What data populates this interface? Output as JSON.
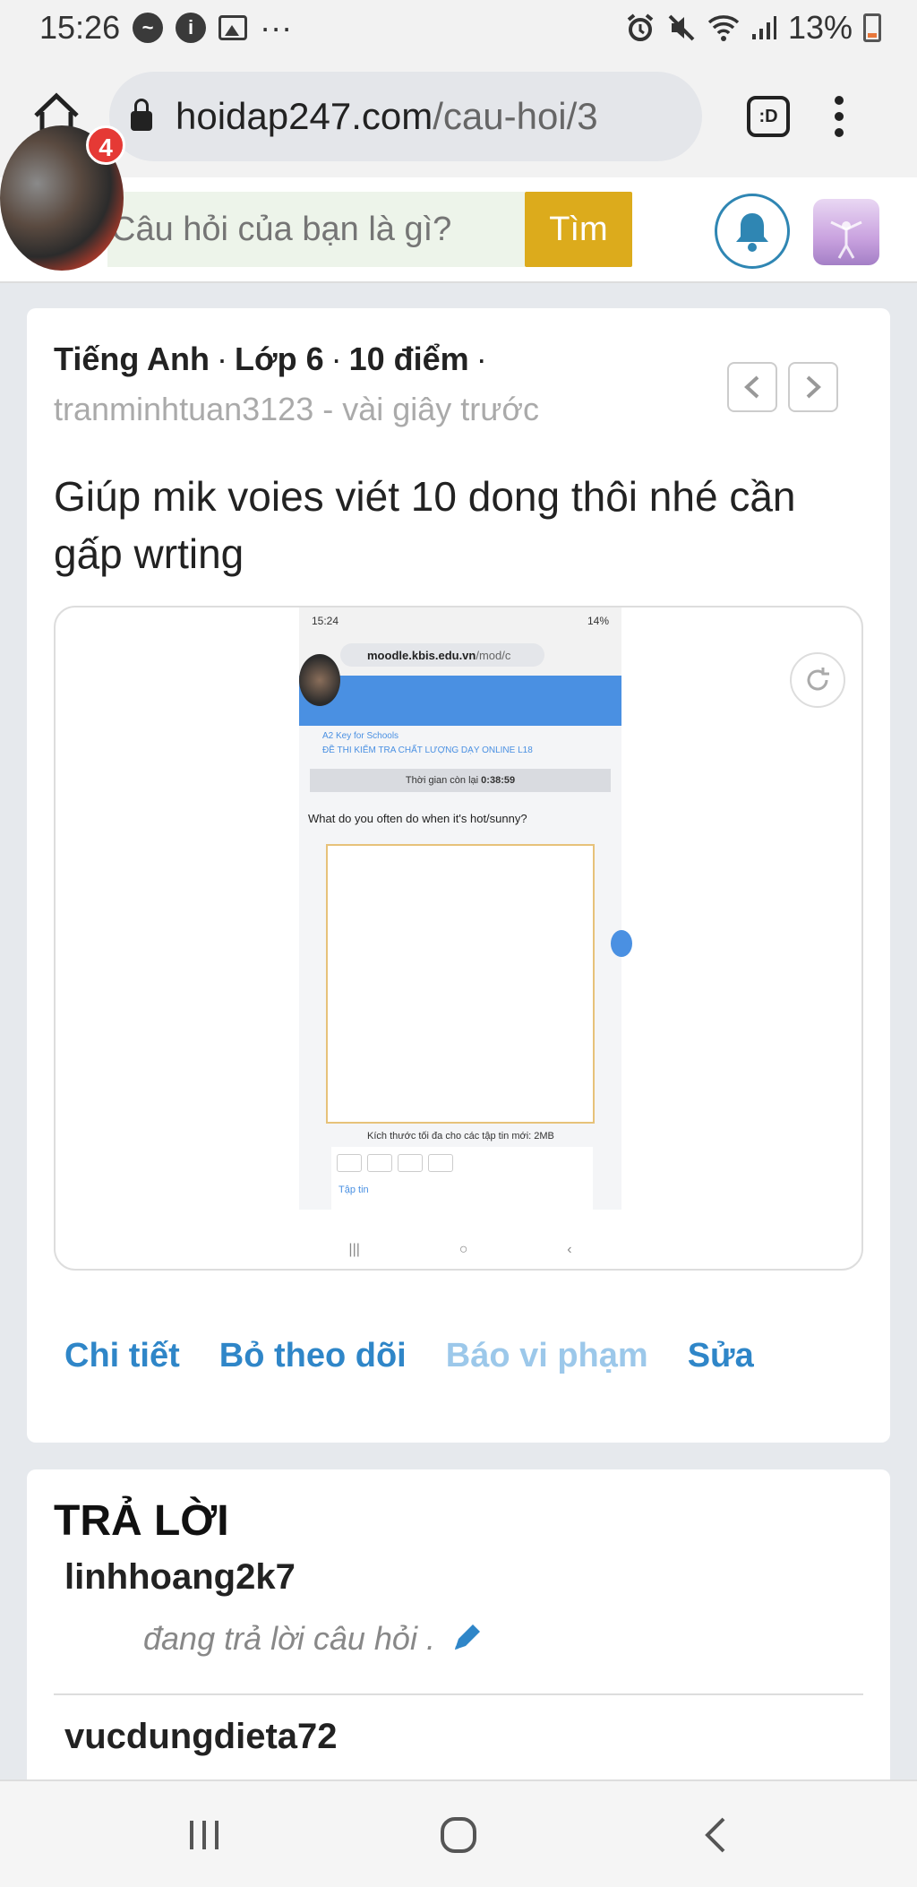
{
  "status_bar": {
    "time": "15:26",
    "more": "···",
    "battery": "13%"
  },
  "browser": {
    "url_domain": "hoidap247.com",
    "url_path": "/cau-hoi/3",
    "tabs_label": ":D"
  },
  "chat_head": {
    "badge": "4"
  },
  "site_header": {
    "search_placeholder": "Câu hỏi của bạn là gì?",
    "search_button": "Tìm"
  },
  "question": {
    "subject": "Tiếng Anh",
    "grade": "Lớp 6",
    "points": "10 điểm",
    "separator": "·",
    "author": "tranminhtuan3123",
    "time": "vài giây trước",
    "text": "Giúp mik voies viét 10 dong thôi nhé cần gấp wrting",
    "attachment": {
      "status_time": "15:24",
      "status_right": "14%",
      "url_domain": "moodle.kbis.edu.vn",
      "url_path": "/mod/c",
      "crumb_1": "A2 Key for Schools",
      "crumb_2": "ĐỀ THI KIỂM TRA CHẤT LƯỢNG DẠY ONLINE L18",
      "timer_label": "Thời gian còn lại",
      "timer_value": "0:38:59",
      "prompt": "What do you often do when it's hot/sunny?",
      "max_size": "Kích thước tối đa cho các tập tin mới: 2MB",
      "files_label": "Tập tin"
    },
    "actions": {
      "details": "Chi tiết",
      "unfollow": "Bỏ theo dõi",
      "report": "Báo vi phạm",
      "edit": "Sửa"
    }
  },
  "answers": {
    "title": "TRẢ LỜI",
    "items": [
      {
        "user": "linhhoang2k7",
        "status": "đang trả lời câu hỏi ."
      },
      {
        "user": "vucdungdieta72"
      }
    ]
  },
  "colors": {
    "accent_blue": "#2f86c8",
    "search_button": "#dcab1c",
    "badge_red": "#e53935"
  }
}
